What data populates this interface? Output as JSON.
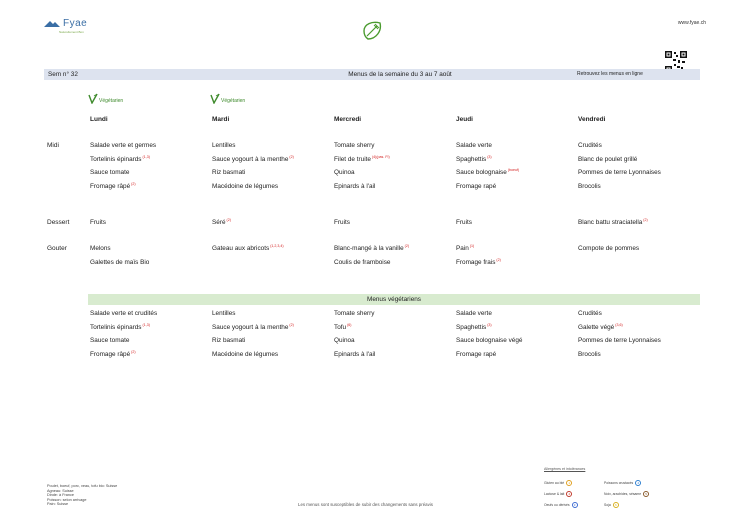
{
  "brand": {
    "name": "Fyae",
    "tagline": "Naturellement Bon",
    "website": "www.fyae.ch"
  },
  "header": {
    "week": "Sem n° 32",
    "title": "Menus de la semaine du 3 au 7 août",
    "online": "Retrouvez les menus en ligne"
  },
  "veg_badge": "Végétarien",
  "days": [
    "Lundi",
    "Mardi",
    "Mercredi",
    "Jeudi",
    "Vendredi"
  ],
  "sections": {
    "midi": "Midi",
    "dessert": "Dessert",
    "gouter": "Gouter"
  },
  "midi": [
    [
      {
        "t": "Salade verte et germes",
        "s": ""
      },
      {
        "t": "Tortelinis épinards",
        "s": "(1,3)"
      },
      {
        "t": "Sauce tomate",
        "s": ""
      },
      {
        "t": "Fromage râpé",
        "s": "(2)"
      }
    ],
    [
      {
        "t": "Lentilles",
        "s": ""
      },
      {
        "t": "Sauce yogourt à la menthe",
        "s": "(2)"
      },
      {
        "t": "Riz basmati",
        "s": ""
      },
      {
        "t": "Macédoine de légumes",
        "s": ""
      }
    ],
    [
      {
        "t": "Tomate sherry",
        "s": ""
      },
      {
        "t": "Filet de truite",
        "s": "(4)(pas. FI)"
      },
      {
        "t": "Quinoa",
        "s": ""
      },
      {
        "t": "Epinards à l'ail",
        "s": ""
      }
    ],
    [
      {
        "t": "Salade verte",
        "s": ""
      },
      {
        "t": "Spaghettis",
        "s": "(3)"
      },
      {
        "t": "Sauce bolognaise",
        "s": "(boeuf)"
      },
      {
        "t": "Fromage rapé",
        "s": ""
      }
    ],
    [
      {
        "t": "Crudités",
        "s": ""
      },
      {
        "t": "Blanc de poulet grillé",
        "s": ""
      },
      {
        "t": "Pommes de terre Lyonnaises",
        "s": ""
      },
      {
        "t": "Brocolis",
        "s": ""
      }
    ]
  ],
  "dessert": [
    {
      "t": "Fruits",
      "s": ""
    },
    {
      "t": "Séré",
      "s": "(2)"
    },
    {
      "t": "Fruits",
      "s": ""
    },
    {
      "t": "Fruits",
      "s": ""
    },
    {
      "t": "Blanc battu straciatella",
      "s": "(2)"
    }
  ],
  "gouter": [
    [
      {
        "t": "Melons",
        "s": ""
      },
      {
        "t": "Galettes de maïs Bio",
        "s": ""
      }
    ],
    [
      {
        "t": "Gateau aux abricots",
        "s": "(1,2,3,4)"
      }
    ],
    [
      {
        "t": "Blanc-mangé à la vanille",
        "s": "(2)"
      },
      {
        "t": "Coulis de framboise",
        "s": ""
      }
    ],
    [
      {
        "t": "Pain",
        "s": "(1)"
      },
      {
        "t": "Fromage frais",
        "s": "(2)"
      }
    ],
    [
      {
        "t": "Compote de pommes",
        "s": ""
      }
    ]
  ],
  "veg_title": "Menus végétariens",
  "veg": [
    [
      {
        "t": "Salade verte et crudités",
        "s": ""
      },
      {
        "t": "Tortelinis épinards",
        "s": "(1,3)"
      },
      {
        "t": "Sauce tomate",
        "s": ""
      },
      {
        "t": "Fromage râpé",
        "s": "(2)"
      }
    ],
    [
      {
        "t": "Lentilles",
        "s": ""
      },
      {
        "t": "Sauce yogourt à la menthe",
        "s": "(2)"
      },
      {
        "t": "Riz basmati",
        "s": ""
      },
      {
        "t": "Macédoine de légumes",
        "s": ""
      }
    ],
    [
      {
        "t": "Tomate sherry",
        "s": ""
      },
      {
        "t": "Tofu",
        "s": "(6)"
      },
      {
        "t": "Quinoa",
        "s": ""
      },
      {
        "t": "Epinards à l'ail",
        "s": ""
      }
    ],
    [
      {
        "t": "Salade verte",
        "s": ""
      },
      {
        "t": "Spaghettis",
        "s": "(3)"
      },
      {
        "t": "Sauce bolognaise végé",
        "s": ""
      },
      {
        "t": "Fromage rapé",
        "s": ""
      }
    ],
    [
      {
        "t": "Crudités",
        "s": ""
      },
      {
        "t": "Galette végé",
        "s": "(3,6)"
      },
      {
        "t": "Pommes de terre Lyonnaises",
        "s": ""
      },
      {
        "t": "Brocolis",
        "s": ""
      }
    ]
  ],
  "origins": [
    "Poulet, boeuf, porc, veau, tofu bio: Suisse",
    "Agneau: Suisse",
    "Dinde: à France",
    "Poisson: selon arrivage",
    "Pain: Suisse"
  ],
  "footer_note": "Les menus sont susceptibles de subir des changements sans préavis",
  "legend": {
    "title": "Allergènes et intolérances",
    "items": [
      {
        "label": "Gluten au blé",
        "code": "1",
        "color": "#e0a020"
      },
      {
        "label": "Lactose & lait",
        "code": "2",
        "color": "#c03a2b"
      },
      {
        "label": "Oeufs ou dérivés",
        "code": "3",
        "color": "#3d6bd1"
      },
      {
        "label": "Poissons crustacés",
        "code": "4",
        "color": "#2e7fd0"
      },
      {
        "label": "Noix, arachides, sésame",
        "code": "5",
        "color": "#8a5a2b"
      },
      {
        "label": "Soja",
        "code": "6",
        "color": "#d8b020"
      }
    ]
  }
}
